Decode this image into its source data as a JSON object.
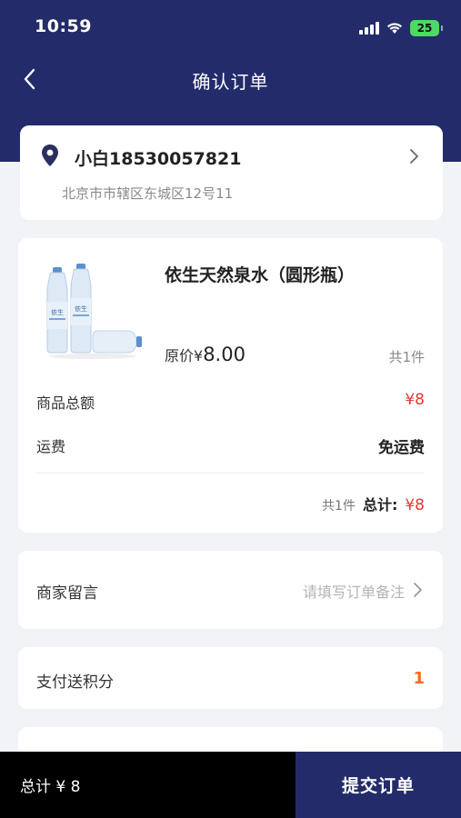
{
  "status_bar": {
    "time": "10:59",
    "battery": "25"
  },
  "nav": {
    "title": "确认订单",
    "back_icon": "chevron-left-icon"
  },
  "address": {
    "name_phone": "小白18530057821",
    "detail": "北京市市辖区东城区12号11",
    "icon": "location-pin-icon"
  },
  "product": {
    "name": "依生天然泉水（圆形瓶）",
    "price_label": "原价¥",
    "price_value": "8.00",
    "quantity": "共1件",
    "subtotal_label": "商品总额",
    "subtotal_value": "¥8",
    "shipping_label": "运费",
    "shipping_value": "免运费",
    "total_count": "共1件",
    "total_label": "总计:",
    "total_value": "¥8"
  },
  "remark": {
    "label": "商家留言",
    "placeholder": "请填写订单备注"
  },
  "points": {
    "label": "支付送积分",
    "value": "1"
  },
  "bottom": {
    "total": "总计 ¥ 8",
    "submit_label": "提交订单"
  },
  "colors": {
    "brand": "#242b6b",
    "price_red": "#e53935",
    "points_orange": "#f36b21",
    "page_bg": "#f2f3f7"
  }
}
